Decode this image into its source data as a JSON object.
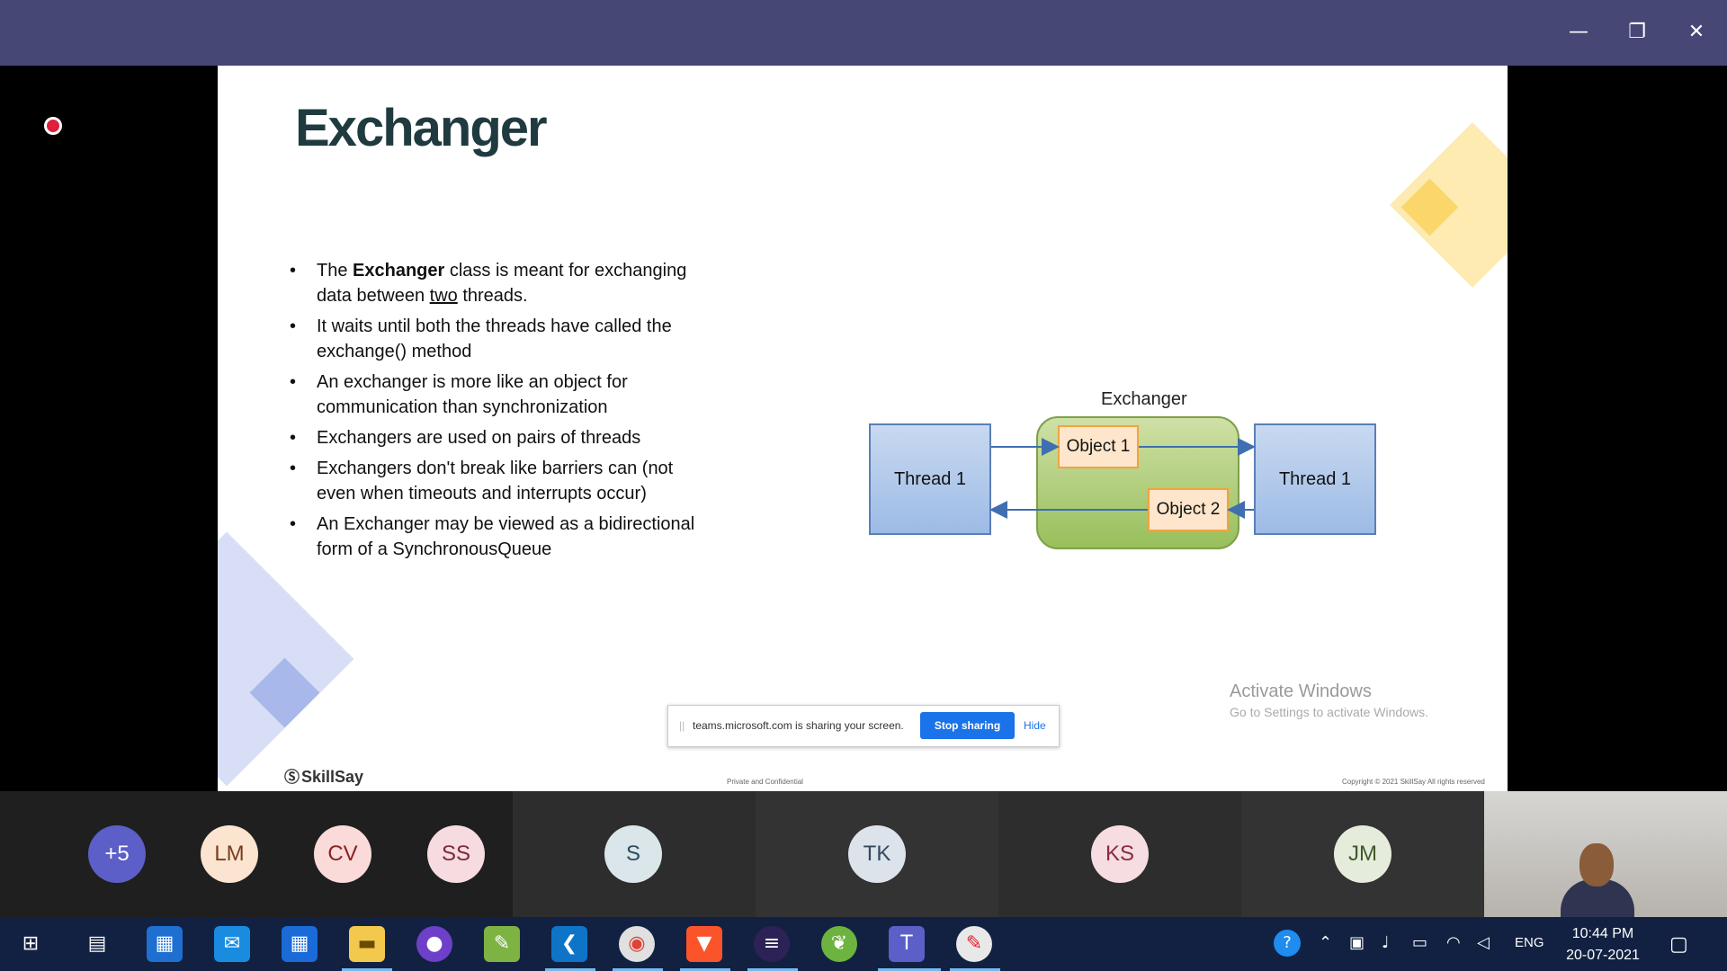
{
  "window": {
    "minimize_icon": "minimize-icon",
    "maximize_icon": "restore-icon",
    "close_icon": "close-icon",
    "bar_color": "#464775"
  },
  "slide": {
    "title": "Exchanger",
    "bullets": [
      {
        "pre": "The ",
        "bold": "Exchanger",
        "post": " class is meant for exchanging data between ",
        "underline": "two",
        "tail": " threads."
      },
      {
        "text": "It waits until both the threads have called the exchange() method"
      },
      {
        "text": "An exchanger is more like an object for communication than synchronization"
      },
      {
        "text": "Exchangers are used on pairs of threads"
      },
      {
        "text": "Exchangers don't break like barriers can (not even when timeouts and interrupts occur)"
      },
      {
        "text": "An Exchanger may be viewed as a bidirectional form of a SynchronousQueue"
      }
    ],
    "diagram": {
      "label": "Exchanger",
      "thread_left": "Thread 1",
      "thread_right": "Thread 1",
      "object1": "Object 1",
      "object2": "Object 2"
    },
    "brand": "SkillSay",
    "confidential": "Private and Confidential",
    "copyright": "Copyright © 2021 SkillSay All rights reserved"
  },
  "share_bar": {
    "text": "teams.microsoft.com is sharing your screen.",
    "stop": "Stop sharing",
    "hide": "Hide"
  },
  "watermark": {
    "title": "Activate Windows",
    "subtitle": "Go to Settings to activate Windows."
  },
  "participants": [
    {
      "initials": "+5",
      "bg": "#5b5fc7",
      "fg": "#ffffff"
    },
    {
      "initials": "LM",
      "bg": "#fbe4d0",
      "fg": "#7a3d1b"
    },
    {
      "initials": "CV",
      "bg": "#fbdada",
      "fg": "#8b2222"
    },
    {
      "initials": "SS",
      "bg": "#f6dbe0",
      "fg": "#7b2a3a"
    },
    {
      "initials": "S",
      "bg": "#dbe6ea",
      "fg": "#284e5e"
    },
    {
      "initials": "TK",
      "bg": "#dde3ea",
      "fg": "#34495e"
    },
    {
      "initials": "KS",
      "bg": "#f6dde2",
      "fg": "#8b2a3e"
    },
    {
      "initials": "JM",
      "bg": "#e6ecdc",
      "fg": "#3f5a2b"
    }
  ],
  "taskbar": {
    "apps": [
      "windows-start-icon",
      "task-view-icon",
      "microsoft-store-icon",
      "mail-icon",
      "calendar-icon",
      "file-explorer-icon",
      "github-icon",
      "notepad-icon",
      "vscode-icon",
      "chrome-icon",
      "brave-icon",
      "eclipse-icon",
      "spring-icon",
      "teams-icon",
      "paint-icon"
    ],
    "language": "ENG",
    "time": "10:44 PM",
    "date": "20-07-2021"
  }
}
